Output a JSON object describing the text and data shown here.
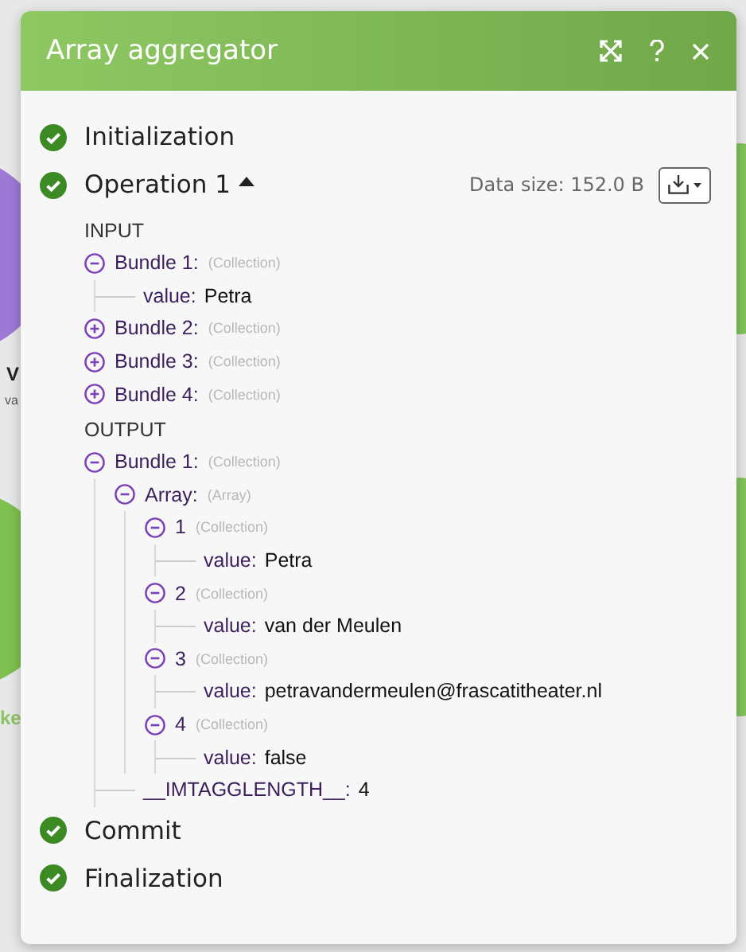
{
  "canvas": {
    "labels": [
      {
        "kind": "title",
        "text": "V"
      },
      {
        "kind": "subtitle",
        "text": "va"
      },
      {
        "kind": "left-green",
        "text": "ke"
      }
    ]
  },
  "dialog": {
    "title": "Array aggregator",
    "steps": [
      {
        "kind": "step",
        "label": "Initialization",
        "done": true
      },
      {
        "kind": "operation",
        "label": "Operation 1",
        "done": true,
        "expanded": true,
        "data_size": "Data size: 152.0 B",
        "sections": [
          {
            "title": "INPUT",
            "items": [
              {
                "key": "Bundle 1:",
                "type": "(Collection)",
                "expanded": true,
                "children": [
                  {
                    "key": "value:",
                    "value": "Petra"
                  }
                ]
              },
              {
                "key": "Bundle 2:",
                "type": "(Collection)",
                "expanded": false
              },
              {
                "key": "Bundle 3:",
                "type": "(Collection)",
                "expanded": false
              },
              {
                "key": "Bundle 4:",
                "type": "(Collection)",
                "expanded": false
              }
            ]
          },
          {
            "title": "OUTPUT",
            "items": [
              {
                "key": "Bundle 1:",
                "type": "(Collection)",
                "expanded": true,
                "children": [
                  {
                    "key": "Array:",
                    "type": "(Array)",
                    "expanded": true,
                    "children": [
                      {
                        "key": "1",
                        "type": "(Collection)",
                        "expanded": true,
                        "children": [
                          {
                            "key": "value:",
                            "value": "Petra"
                          }
                        ]
                      },
                      {
                        "key": "2",
                        "type": "(Collection)",
                        "expanded": true,
                        "children": [
                          {
                            "key": "value:",
                            "value": "van der Meulen"
                          }
                        ]
                      },
                      {
                        "key": "3",
                        "type": "(Collection)",
                        "expanded": true,
                        "children": [
                          {
                            "key": "value:",
                            "value": "petravandermeulen@frascatitheater.nl"
                          }
                        ]
                      },
                      {
                        "key": "4",
                        "type": "(Collection)",
                        "expanded": true,
                        "children": [
                          {
                            "key": "value:",
                            "value": "false"
                          }
                        ]
                      }
                    ]
                  },
                  {
                    "key": "__IMTAGGLENGTH__:",
                    "value": "4"
                  }
                ]
              }
            ]
          }
        ]
      },
      {
        "kind": "step",
        "label": "Commit",
        "done": true
      },
      {
        "kind": "step",
        "label": "Finalization",
        "done": true
      }
    ]
  }
}
